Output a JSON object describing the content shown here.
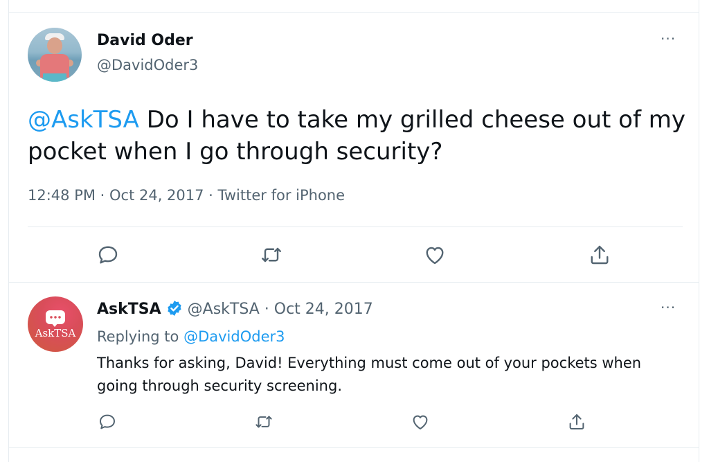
{
  "tweet": {
    "author_name": "David Oder",
    "author_handle": "@DavidOder3",
    "mention": "@AskTSA",
    "text": " Do I have to take my grilled cheese out of my pocket when I go through security?",
    "meta": "12:48 PM · Oct 24, 2017 · Twitter for iPhone",
    "more_icon": "···"
  },
  "reply": {
    "author_name": "AskTSA",
    "author_handle": "@AskTSA",
    "separator": " · ",
    "date": "Oct 24, 2017",
    "avatar_label": "AskTSA",
    "replying_prefix": "Replying to ",
    "replying_to": "@DavidOder3",
    "text": "Thanks for asking, David! Everything must come out of your pockets when going through security screening.",
    "more_icon": "···"
  },
  "colors": {
    "accent": "#1d9bf0",
    "secondary_text": "#536471",
    "divider": "#e6ecf0",
    "asktsa_brand": "#d94d5a"
  },
  "icons": [
    "reply-icon",
    "retweet-icon",
    "like-icon",
    "share-icon",
    "verified-badge-icon",
    "more-icon"
  ]
}
